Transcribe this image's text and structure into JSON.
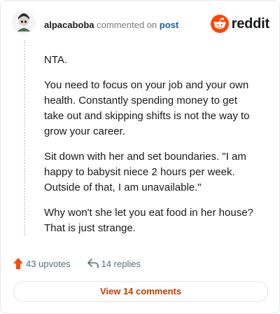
{
  "header": {
    "username": "alpacaboba",
    "action_text": " commented on ",
    "post_link": "post",
    "brand": "reddit"
  },
  "comment": {
    "paragraphs": [
      "NTA.",
      "You need to focus on your job and your own health. Constantly spending money to get take out and skipping shifts is not the way to grow your career.",
      "Sit down with her and set boundaries. \"I am happy to babysit niece 2 hours per week. Outside of that, I am unavailable.\"",
      "Why won't she let you eat food in her house? That is just strange."
    ]
  },
  "actions": {
    "upvotes": "43 upvotes",
    "replies": "14 replies"
  },
  "footer": {
    "view_button": "View 14 comments"
  },
  "colors": {
    "accent": "#ff4500",
    "link": "#1a5fb4",
    "view_button_text": "#c43c00"
  },
  "icons": {
    "avatar": "avatar-icon",
    "logo": "reddit-logo-icon",
    "upvote": "upvote-arrow-icon",
    "reply": "reply-arrow-icon"
  }
}
